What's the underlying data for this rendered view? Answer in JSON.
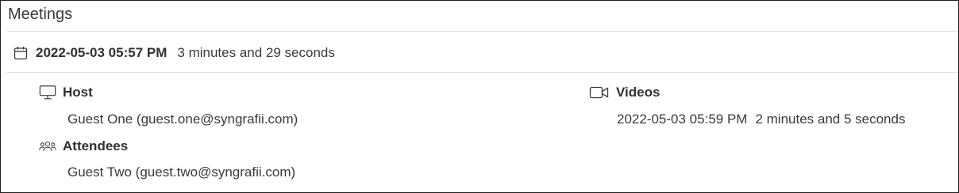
{
  "section": {
    "title": "Meetings"
  },
  "meeting": {
    "date": "2022-05-03 05:57 PM",
    "duration": "3 minutes and 29 seconds",
    "icon": "calendar-icon"
  },
  "host": {
    "label": "Host",
    "icon": "monitor-icon",
    "value": "Guest One (guest.one@syngrafii.com)"
  },
  "attendees": {
    "label": "Attendees",
    "icon": "people-icon",
    "value": "Guest Two (guest.two@syngrafii.com)"
  },
  "videos": {
    "label": "Videos",
    "icon": "video-camera-icon",
    "items": [
      {
        "date": "2022-05-03 05:59 PM",
        "duration": "2 minutes and 5 seconds"
      }
    ]
  },
  "colors": {
    "text": "#323130",
    "muted": "#3b3a39",
    "divider": "#e1dfdd",
    "border": "#1f1f1f"
  }
}
